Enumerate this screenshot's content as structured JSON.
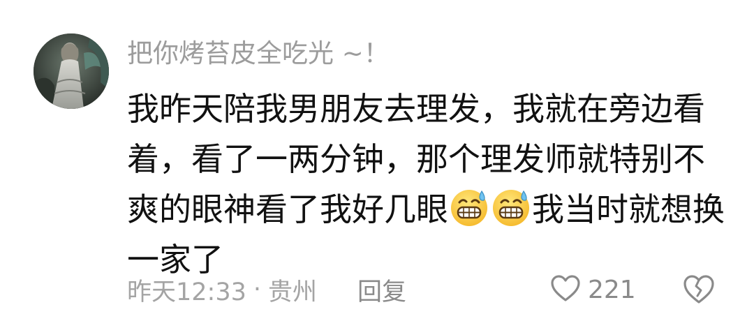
{
  "comment": {
    "username": "把你烤苔皮全吃光 ~！",
    "text_parts": {
      "before_emoji": "我昨天陪我男朋友去理发，我就在旁边看着，看了一两分钟，那个理发师就特别不爽的眼神看了我好几眼",
      "after_emoji": "我当时就想换一家了"
    },
    "emoji_icons": [
      "sweat-grin-emoji",
      "sweat-grin-emoji"
    ],
    "time": "昨天12:33",
    "separator": "·",
    "location": "贵州",
    "reply_label": "回复",
    "likes": "221",
    "icons": {
      "like": "heart-outline-icon",
      "dislike": "broken-heart-outline-icon"
    },
    "colors": {
      "username": "#9c9c9c",
      "body": "#111111",
      "meta": "#a4a4a4",
      "action": "#8a8a8a"
    }
  }
}
